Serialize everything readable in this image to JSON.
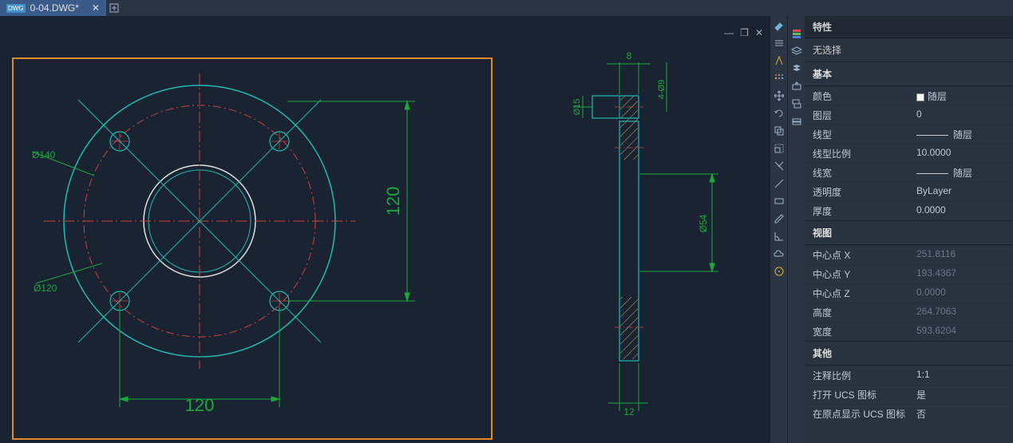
{
  "tab": {
    "title": "0-04.DWG*",
    "close": "✕"
  },
  "window_controls": {
    "min": "—",
    "max": "❐",
    "close": "✕"
  },
  "drawing": {
    "dims": {
      "horiz": "120",
      "vert": "120",
      "d140": "Ø140",
      "d120": "Ø120",
      "top8": "8",
      "side_4_99": "4-Ø9",
      "d15": "Ø15",
      "r54": "Ø54",
      "bot12": "12"
    }
  },
  "props": {
    "title": "特性",
    "none_selected": "无选择",
    "sections": {
      "basic": "基本",
      "view": "视图",
      "other": "其他"
    },
    "basic": {
      "color_label": "颜色",
      "color_value": "随层",
      "layer_label": "图层",
      "layer_value": "0",
      "linetype_label": "线型",
      "linetype_value": "随层",
      "ltscale_label": "线型比例",
      "ltscale_value": "10.0000",
      "lineweight_label": "线宽",
      "lineweight_value": "随层",
      "transparency_label": "透明度",
      "transparency_value": "ByLayer",
      "thickness_label": "厚度",
      "thickness_value": "0.0000"
    },
    "view": {
      "cx_label": "中心点 X",
      "cx_value": "251.8116",
      "cy_label": "中心点 Y",
      "cy_value": "193.4367",
      "cz_label": "中心点 Z",
      "cz_value": "0.0000",
      "h_label": "高度",
      "h_value": "264.7063",
      "w_label": "宽度",
      "w_value": "593.6204"
    },
    "other": {
      "annoscale_label": "注释比例",
      "annoscale_value": "1:1",
      "ucs_open_label": "打开 UCS 图标",
      "ucs_open_value": "是",
      "ucs_origin_label": "在原点显示 UCS 图标",
      "ucs_origin_value": "否"
    }
  }
}
